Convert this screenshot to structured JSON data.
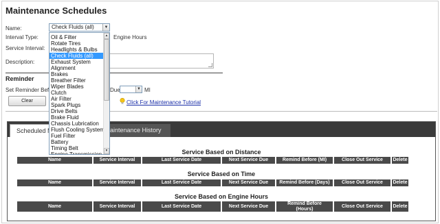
{
  "page": {
    "title": "Maintenance Schedules"
  },
  "form": {
    "name_label": "Name:",
    "name_selected": "Check Fluids (all)",
    "interval_type_label": "Interval Type:",
    "engine_hours_option": "Engine Hours",
    "service_interval_label": "Service Interval:",
    "description_label": "Description:"
  },
  "dropdown": {
    "items": [
      "Oil & Filter",
      "Rotate Tires",
      "Headlights & Bulbs",
      "Check Fluids (all)",
      "Exhaust System",
      "Alignment",
      "Brakes",
      "Breather Filter",
      "Wiper Blades",
      "Clutch",
      "Air Filter",
      "Spark Plugs",
      "Drive Belts",
      "Brake Fluid",
      "Chassis Lubrication",
      "Flush Cooling System",
      "Fuel Filter",
      "Battery",
      "Timing Belt",
      "Engine Transmission"
    ],
    "selected_index": 3
  },
  "reminder": {
    "heading": "Reminder",
    "set_label": "Set Reminder Bef",
    "due_label": "Due",
    "mi_label": "MI",
    "clear_button": "Clear",
    "tutorial_link": "Click For Maintenance Tutorial"
  },
  "tabs": [
    {
      "label": "Scheduled M"
    },
    {
      "label": "aintenance History"
    }
  ],
  "sections": [
    {
      "title": "Service Based on Distance",
      "headers": [
        "Name",
        "Service Interval",
        "Last Service Date",
        "Next Service Due",
        "Remind Before (MI)",
        "Close Out Service",
        "Delete"
      ]
    },
    {
      "title": "Service Based on Time",
      "headers": [
        "Name",
        "Service Interval",
        "Last Service Date",
        "Next Service Due",
        "Remind Before (Days)",
        "Close Out Service",
        "Delete"
      ]
    },
    {
      "title": "Service Based on Engine Hours",
      "headers": [
        "Name",
        "Service Interval",
        "Last Service Date",
        "Next Service Due",
        "Remind Before (Hours)",
        "Close Out Service",
        "Delete"
      ]
    }
  ],
  "icons": {
    "bulb": "lightbulb-icon",
    "arrow": "chevron-down-icon"
  },
  "colors": {
    "selection": "#3399ff",
    "header_bg": "#4a4a4a",
    "tab_strip": "#3a3a3a",
    "link": "#1a2ea8"
  }
}
